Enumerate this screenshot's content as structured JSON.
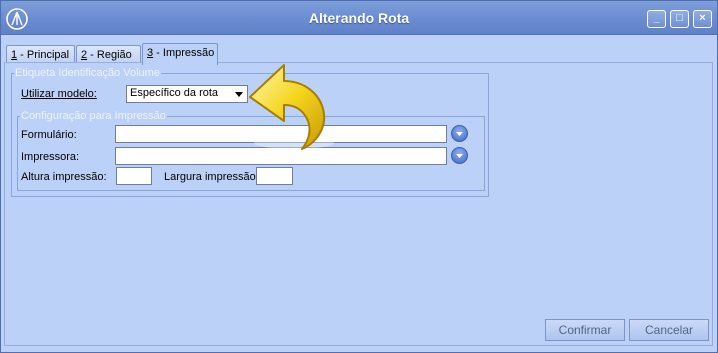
{
  "window": {
    "title": "Alterando Rota",
    "controls": {
      "minimize": "_",
      "maximize": "□",
      "close": "×"
    }
  },
  "tabs": [
    {
      "key": "1",
      "label": " - Principal",
      "active": false
    },
    {
      "key": "2",
      "label": " - Região",
      "active": false
    },
    {
      "key": "3",
      "label": " - Impressão",
      "active": true
    }
  ],
  "etiqueta": {
    "legend": "Etiqueta Identificação Volume",
    "utilizar_modelo_label": "Utilizar modelo:",
    "utilizar_modelo_value": "Específico da rota",
    "config": {
      "legend": "Configuração para Impressão",
      "formulario_label": "Formulário:",
      "formulario_value": "",
      "impressora_label": "Impressora:",
      "impressora_value": "",
      "altura_label": "Altura impressão:",
      "altura_value": "",
      "largura_label": "Largura impressão:",
      "largura_value": ""
    }
  },
  "buttons": {
    "confirmar": "Confirmar",
    "cancelar": "Cancelar"
  },
  "icons": {
    "app": "app-logo-icon",
    "pointer": "yellow-curved-arrow-icon"
  },
  "colors": {
    "background": "#bcd1f7",
    "titlebar": "#6a8bd0",
    "dropdown_button": "#3f67c4",
    "highlight_arrow": "#f2d21a"
  }
}
